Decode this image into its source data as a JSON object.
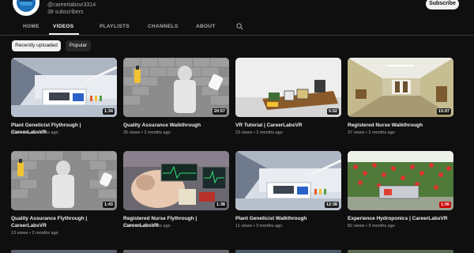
{
  "channel": {
    "handle": "@careerlabsvr3314",
    "subscribers": "38 subscribers",
    "subscribe_label": "Subscribe"
  },
  "tabs": [
    {
      "label": "HOME"
    },
    {
      "label": "VIDEOS"
    },
    {
      "label": "PLAYLISTS"
    },
    {
      "label": "CHANNELS"
    },
    {
      "label": "ABOUT"
    }
  ],
  "active_tab": "VIDEOS",
  "search_icon": "search-icon",
  "chips": [
    {
      "label": "Recently uploaded",
      "selected": true
    },
    {
      "label": "Popular",
      "selected": false
    }
  ],
  "videos": [
    {
      "title": "Plant Geneticist Flythrough | CareerLabsVR",
      "meta": "26 views • 2 months ago",
      "duration": "1:34"
    },
    {
      "title": "Quality Assurance Walkthrough",
      "meta": "25 views • 2 months ago",
      "duration": "20:57"
    },
    {
      "title": "VR Tutorial | CareerLabsVR",
      "meta": "23 views • 2 months ago",
      "duration": "5:52"
    },
    {
      "title": "Registered Nurse Walkthrough",
      "meta": "37 views • 2 months ago",
      "duration": "15:07"
    },
    {
      "title": "Quality Assurance Flythrough | CareerLabsVR",
      "meta": "13 views • 2 months ago",
      "duration": "1:43"
    },
    {
      "title": "Registered Nurse Flythrough | CareerLabsVR",
      "meta": "27 views • 2 months ago",
      "duration": "1:38"
    },
    {
      "title": "Plant Geneticist Walkthrough",
      "meta": "11 views • 3 months ago",
      "duration": "12:38"
    },
    {
      "title": "Experience Hydroponics | CareerLabsVR",
      "meta": "82 views • 3 months ago",
      "duration": "1:06"
    }
  ],
  "colors": {
    "background": "#0f0f0f",
    "text_primary": "#f1f1f1",
    "text_secondary": "#aaaaaa",
    "chip_bg": "#272727",
    "duration_highlight": "#cc0000"
  }
}
